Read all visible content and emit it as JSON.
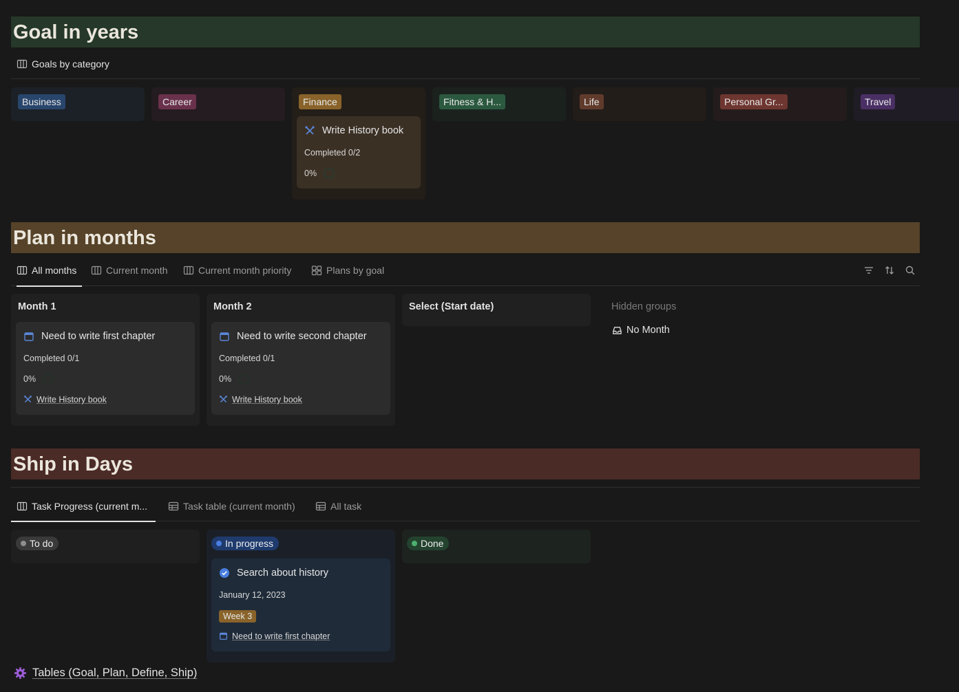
{
  "goals": {
    "banner": "Goal in years",
    "view_label": "Goals by category",
    "categories": [
      {
        "label": "Business",
        "color": "#28456c"
      },
      {
        "label": "Career",
        "color": "#69314c"
      },
      {
        "label": "Finance",
        "color": "#89632a"
      },
      {
        "label": "Fitness & H...",
        "color": "#2b593f"
      },
      {
        "label": "Life",
        "color": "#603b2c"
      },
      {
        "label": "Personal Gr...",
        "color": "#6e3630"
      },
      {
        "label": "Travel",
        "color": "#492f64"
      }
    ],
    "card": {
      "title": "Write History book",
      "completed": "Completed 0/2",
      "percent": "0%"
    }
  },
  "plans": {
    "banner": "Plan in months",
    "tabs": [
      "All months",
      "Current month",
      "Current month priority",
      "Plans by goal"
    ],
    "groups": [
      {
        "name": "Month 1",
        "card": {
          "title": "Need to write first chapter",
          "completed": "Completed 0/1",
          "percent": "0%",
          "goal": "Write History book"
        }
      },
      {
        "name": "Month 2",
        "card": {
          "title": "Need to write second chapter",
          "completed": "Completed 0/1",
          "percent": "0%",
          "goal": "Write History book"
        }
      },
      {
        "name": "Select (Start date)"
      }
    ],
    "hidden_groups_label": "Hidden groups",
    "hidden_group": "No Month"
  },
  "ship": {
    "banner": "Ship in Days",
    "tabs": [
      "Task Progress (current m...",
      "Task table (current month)",
      "All task"
    ],
    "statuses": [
      {
        "label": "To do",
        "color": "#3a3a3a",
        "dot": "#8e8e8e"
      },
      {
        "label": "In progress",
        "color": "#1f3b6e",
        "dot": "#4a7ee0"
      },
      {
        "label": "Done",
        "color": "#24432f",
        "dot": "#4caf6e"
      }
    ],
    "card": {
      "title": "Search about history",
      "date": "January 12, 2023",
      "week": "Week 3",
      "plan": "Need to write first chapter"
    }
  },
  "footer": {
    "link": "Tables (Goal, Plan, Define, Ship)"
  }
}
